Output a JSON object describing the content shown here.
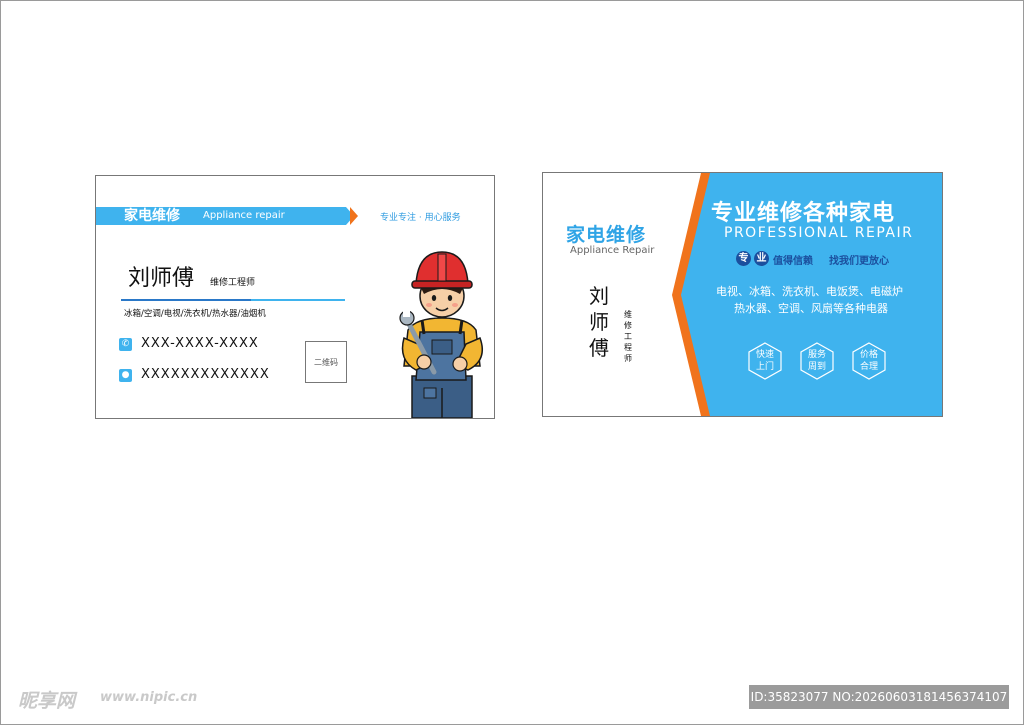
{
  "front": {
    "brand_cn": "家电维修",
    "brand_en": "Appliance repair",
    "slogan": "专业专注 · 用心服务",
    "name": "刘师傅",
    "title": "维修工程师",
    "services": "冰箱/空调/电视/洗衣机/热水器/油烟机",
    "phone": "XXX-XXXX-XXXX",
    "address": "XXXXXXXXXXXXX",
    "qr_label": "二维码"
  },
  "back": {
    "brand_cn": "家电维修",
    "brand_en": "Appliance Repair",
    "name_chars": [
      "刘",
      "师",
      "傅"
    ],
    "title_chars": [
      "维",
      "修",
      "工",
      "程",
      "师"
    ],
    "headline": "专业维修各种家电",
    "headline_en": "PROFESSIONAL REPAIR",
    "pill_1": "专",
    "pill_2": "业",
    "trust": "值得信赖",
    "find_us": "找我们更放心",
    "appliances_line1": "电视、冰箱、洗衣机、电饭煲、电磁炉",
    "appliances_line2": "热水器、空调、风扇等各种电器",
    "features": [
      {
        "line1": "快速",
        "line2": "上门"
      },
      {
        "line1": "服务",
        "line2": "周到"
      },
      {
        "line1": "价格",
        "line2": "合理"
      }
    ]
  },
  "watermark": {
    "logo": "昵享网",
    "url": "www.nipic.cn",
    "id": "ID:35823077 NO:20260603181456374107"
  },
  "colors": {
    "primary_blue": "#3fb3ee",
    "accent_orange": "#f0731c",
    "dark_blue": "#1b4f9e"
  }
}
